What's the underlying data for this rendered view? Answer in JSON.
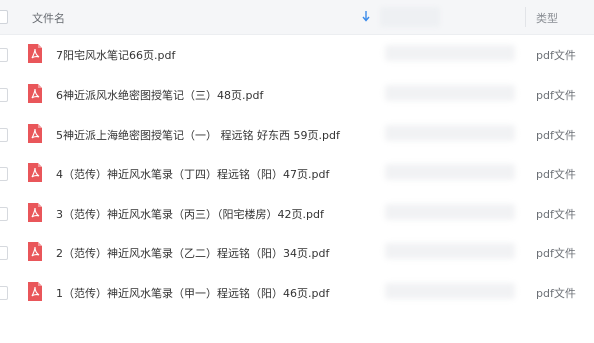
{
  "header": {
    "name_label": "文件名",
    "type_label": "类型",
    "sort_icon": "arrow-down-icon"
  },
  "files": [
    {
      "name": "7阳宅风水笔记66页.pdf",
      "type": "pdf文件",
      "icon": "pdf-icon",
      "icon_color": "#e9565a"
    },
    {
      "name": "6神近派风水绝密图授笔记（三）48页.pdf",
      "type": "pdf文件",
      "icon": "pdf-icon",
      "icon_color": "#e9565a"
    },
    {
      "name": "5神近派上海绝密图授笔记（一） 程远铭 好东西 59页.pdf",
      "type": "pdf文件",
      "icon": "pdf-icon",
      "icon_color": "#e9565a"
    },
    {
      "name": "4（范传）神近风水笔录（丁四）程远铭（阳）47页.pdf",
      "type": "pdf文件",
      "icon": "pdf-icon",
      "icon_color": "#e9565a"
    },
    {
      "name": "3（范传）神近风水笔录（丙三）（阳宅楼房）42页.pdf",
      "type": "pdf文件",
      "icon": "pdf-icon",
      "icon_color": "#e9565a"
    },
    {
      "name": "2（范传）神近风水笔录（乙二）程远铭（阳）34页.pdf",
      "type": "pdf文件",
      "icon": "pdf-icon",
      "icon_color": "#e9565a"
    },
    {
      "name": "1（范传）神近风水笔录（甲一）程远铭（阳）46页.pdf",
      "type": "pdf文件",
      "icon": "pdf-icon",
      "icon_color": "#e9565a"
    }
  ],
  "colors": {
    "sort_arrow": "#3b8bea"
  }
}
